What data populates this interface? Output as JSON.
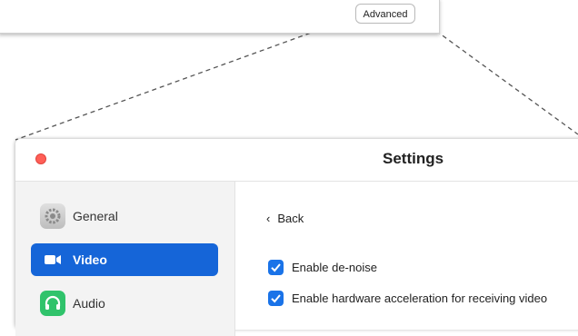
{
  "top_window": {
    "advanced_label": "Advanced"
  },
  "settings": {
    "title": "Settings",
    "sidebar": {
      "items": [
        {
          "label": "General",
          "icon": "gear-icon",
          "active": false
        },
        {
          "label": "Video",
          "icon": "video-camera-icon",
          "active": true
        },
        {
          "label": "Audio",
          "icon": "headphones-icon",
          "active": false
        }
      ]
    },
    "content": {
      "back_label": "Back",
      "options": [
        {
          "label": "Enable de-noise",
          "checked": true
        },
        {
          "label": "Enable hardware acceleration for receiving video",
          "checked": true
        }
      ]
    }
  },
  "colors": {
    "accent": "#1565d8",
    "checkbox": "#1a73e8",
    "close": "#ff5f57",
    "audio_icon": "#30c36b"
  }
}
